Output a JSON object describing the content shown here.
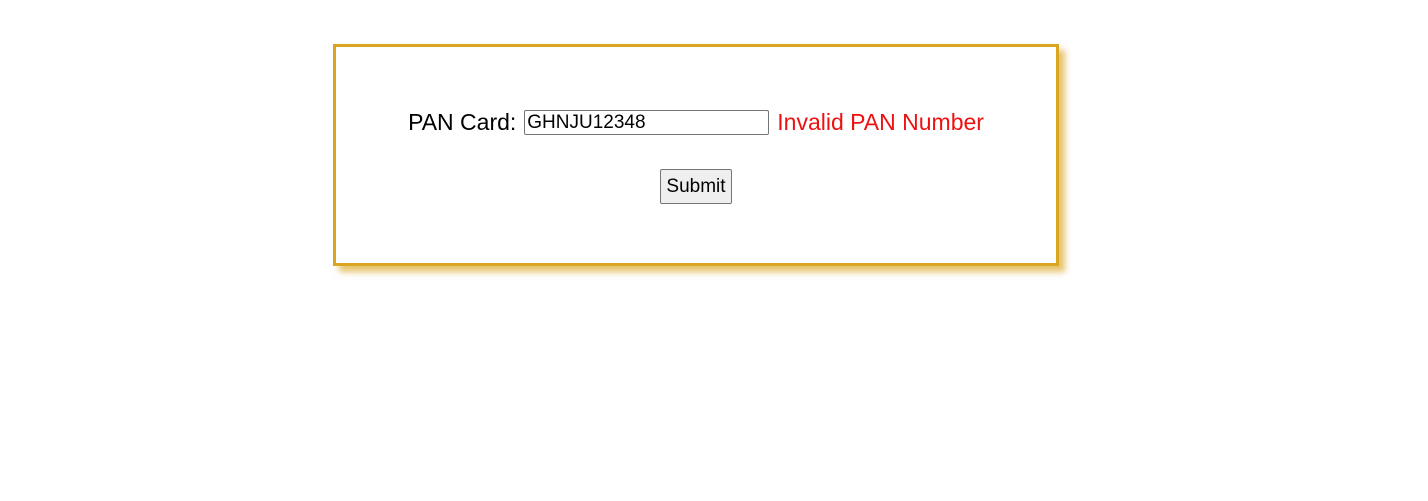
{
  "form": {
    "pan_label": "PAN Card:",
    "pan_value": "GHNJU12348",
    "error_message": "Invalid PAN Number",
    "submit_label": "Submit"
  },
  "colors": {
    "border": "#daa520",
    "error": "#ee1111"
  }
}
